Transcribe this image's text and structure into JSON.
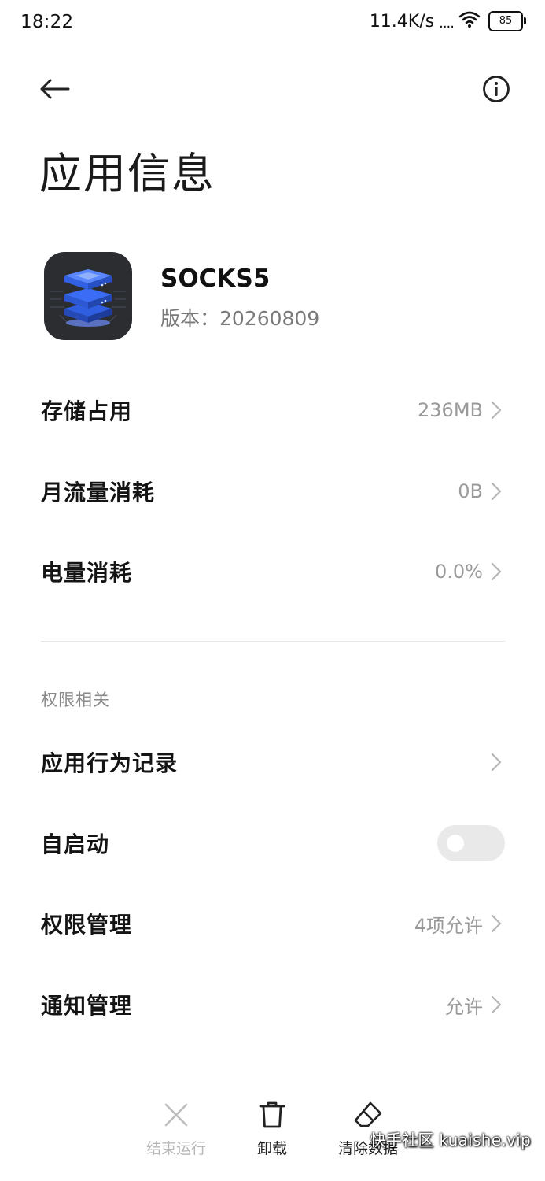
{
  "status_bar": {
    "time": "18:22",
    "net_speed": "11.4K/s",
    "signal": "....",
    "battery": "85",
    "icons": [
      "wifi-icon",
      "battery-icon"
    ]
  },
  "header": {
    "back_icon": "arrow-left-icon",
    "info_icon": "info-circle-icon",
    "title": "应用信息"
  },
  "app": {
    "name": "SOCKS5",
    "version": "版本：20260809",
    "icon": "server-stack-icon"
  },
  "usage_rows": [
    {
      "label": "存储占用",
      "value": "236MB"
    },
    {
      "label": "月流量消耗",
      "value": "0B"
    },
    {
      "label": "电量消耗",
      "value": "0.0%"
    }
  ],
  "permissions": {
    "section_title": "权限相关",
    "rows": [
      {
        "label": "应用行为记录",
        "value": ""
      },
      {
        "label": "自启动",
        "toggle": false
      },
      {
        "label": "权限管理",
        "value": "4项允许"
      },
      {
        "label": "通知管理",
        "value": "允许"
      }
    ]
  },
  "bottom_bar": {
    "actions": [
      {
        "label": "结束运行",
        "icon": "close-x-icon",
        "enabled": false
      },
      {
        "label": "卸载",
        "icon": "trash-icon",
        "enabled": true
      },
      {
        "label": "清除数据",
        "icon": "eraser-icon",
        "enabled": true
      }
    ]
  },
  "watermark": "快手社区 kuaishe.vip",
  "colors": {
    "background": "#ffffff",
    "primary_text": "#141414",
    "secondary_text": "#9a9a9a",
    "section_text": "#8a8a8a",
    "toggle_off": "#e9e9e9",
    "app_icon_bg": "#2b2d31",
    "app_icon_accent": "#3b6cf5"
  }
}
